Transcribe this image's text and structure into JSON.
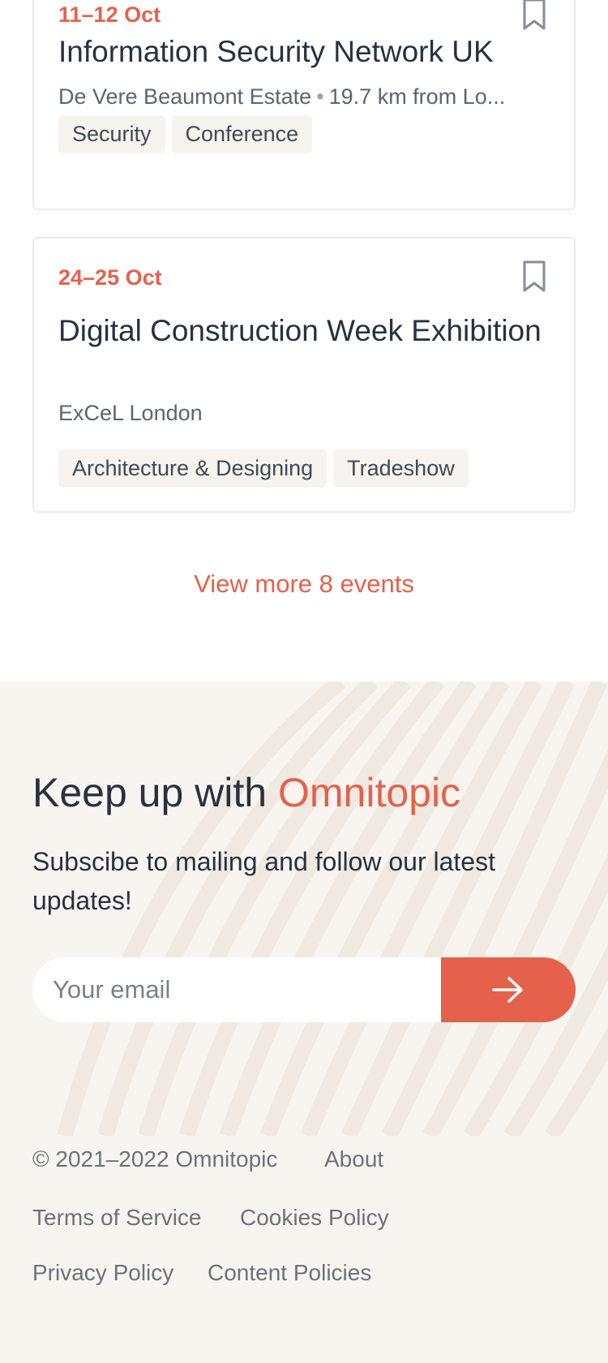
{
  "events": [
    {
      "date": "11–12 Oct",
      "title": "Information Security Network UK",
      "venue": "De Vere Beaumont Estate",
      "distance": "19.7 km from Lo...",
      "tags": [
        "Security",
        "Conference"
      ]
    },
    {
      "date": "24–25 Oct",
      "title": "Digital Construction Week Exhibition",
      "venue": "ExCeL London",
      "tags": [
        "Architecture & Designing",
        "Tradeshow"
      ]
    }
  ],
  "view_more_label": "View more 8 events",
  "newsletter": {
    "title_prefix": "Keep up with ",
    "title_brand": "Omnitopic",
    "subtitle": "Subscibe to mailing and follow our latest updates!",
    "email_placeholder": "Your email",
    "submit_icon": "arrow-right-icon"
  },
  "footer": {
    "copyright": "© 2021–2022 Omnitopic",
    "links": [
      "About",
      "Terms of Service",
      "Cookies Policy",
      "Privacy Policy",
      "Content Policies"
    ]
  },
  "colors": {
    "accent": "#e5614b",
    "text": "#273140",
    "muted": "#6b727b",
    "tag_bg": "#f7f3ee",
    "newsletter_bg": "#f8f5f1"
  }
}
